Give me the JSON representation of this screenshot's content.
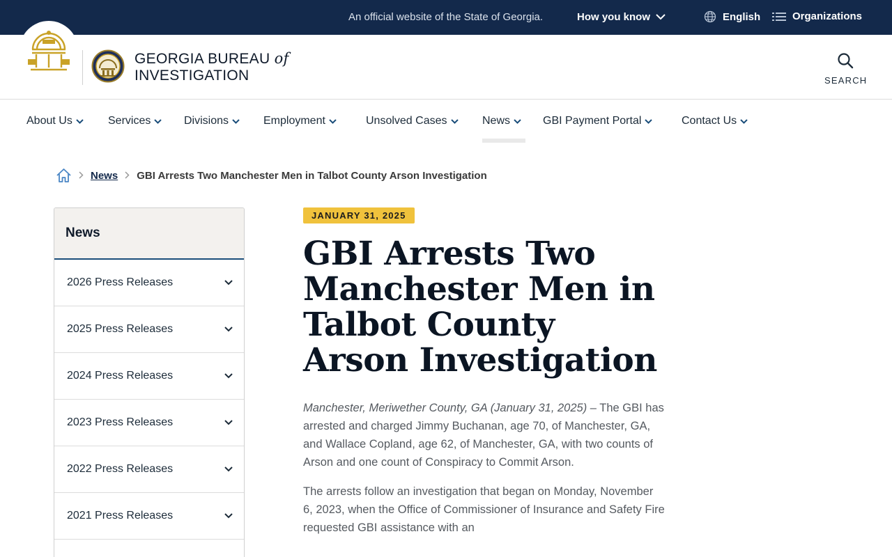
{
  "topbar": {
    "official_text": "An official website of the State of Georgia.",
    "how_you_know": "How you know",
    "language": "English",
    "organizations": "Organizations"
  },
  "header": {
    "brand_line1_prefix": "GEORGIA BUREAU",
    "brand_of": "of",
    "brand_line2": "INVESTIGATION",
    "search_label": "SEARCH"
  },
  "nav": {
    "items": [
      {
        "label": "About Us"
      },
      {
        "label": "Services"
      },
      {
        "label": "Divisions"
      },
      {
        "label": "Employment"
      },
      {
        "label": "Unsolved Cases"
      },
      {
        "label": "News"
      },
      {
        "label": "GBI Payment Portal"
      },
      {
        "label": "Contact Us"
      }
    ],
    "active": "News"
  },
  "breadcrumb": {
    "link": "News",
    "current": "GBI Arrests Two Manchester Men in Talbot County Arson Investigation"
  },
  "sidebar": {
    "heading": "News",
    "items": [
      {
        "label": "2026 Press Releases"
      },
      {
        "label": "2025 Press Releases"
      },
      {
        "label": "2024 Press Releases"
      },
      {
        "label": "2023 Press Releases"
      },
      {
        "label": "2022 Press Releases"
      },
      {
        "label": "2021 Press Releases"
      }
    ]
  },
  "article": {
    "date": "JANUARY 31, 2025",
    "title": "GBI Arrests Two Manchester Men in Talbot County Arson Investigation",
    "dateline": "Manchester, Meriwether County, GA (January 31, 2025)",
    "p1_rest": " – The GBI has arrested and charged Jimmy Buchanan, age 70, of Manchester, GA, and Wallace Copland, age 62, of Manchester, GA, with two counts of Arson and one count of Conspiracy to Commit Arson.",
    "p2": "The arrests follow an investigation that began on Monday, November 6, 2023, when the Office of Commissioner of Insurance and Safety Fire requested GBI assistance with an"
  },
  "colors": {
    "topbar_bg": "#13294b",
    "date_badge": "#f0c23c",
    "sidebar_accent": "#1a4d7a",
    "seal_gold": "#c9a227"
  }
}
